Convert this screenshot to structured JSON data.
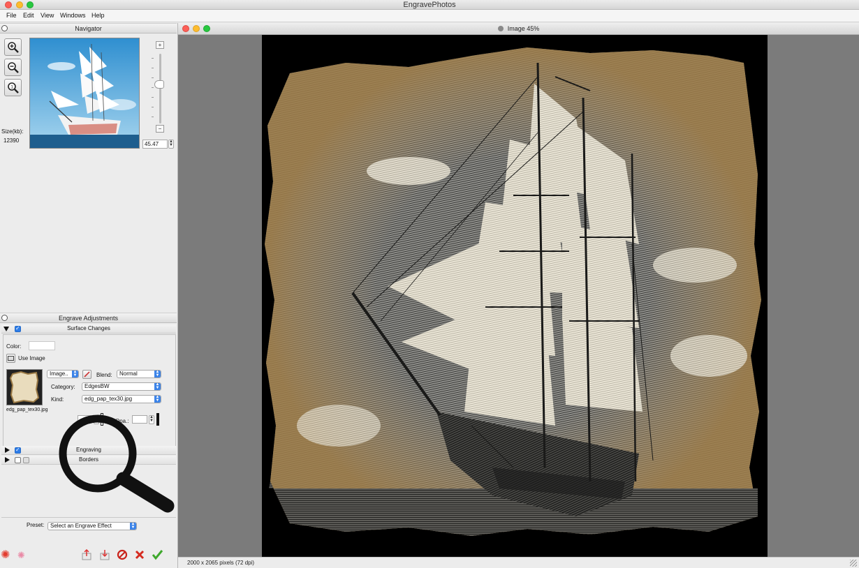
{
  "app": {
    "title": "EngravePhotos"
  },
  "menu": [
    "File",
    "Edit",
    "View",
    "Windows",
    "Help"
  ],
  "navigator": {
    "title": "Navigator",
    "size_label": "Size(kb):",
    "size_value": "12390",
    "zoom_value": "45.47"
  },
  "adjustments": {
    "title": "Engrave Adjustments",
    "surface": {
      "title": "Surface Changes",
      "color_label": "Color:",
      "use_image_label": "Use Image",
      "source_select": "Image..",
      "blend_label": "Blend:",
      "blend_value": "Normal",
      "category_label": "Category:",
      "category_value": "EdgesBW",
      "kind_label": "Kind:",
      "kind_value": "edg_pap_tex30.jpg",
      "thumb_caption": "edg_pap_tex30.jpg",
      "opacity_label": "Opa.:"
    },
    "engraving_title": "Engraving",
    "borders_title": "Borders",
    "preset_label": "Preset:",
    "preset_value": "Select an Engrave Effect"
  },
  "document": {
    "title": "Image 45%",
    "status": "2000 x 2065 pixels (72 dpi)"
  },
  "colors": {
    "accent": "#2e7de8",
    "canvas_gray": "#7b7b7b",
    "paper": "#e9e1cf",
    "sepia": "#b79a6a"
  }
}
